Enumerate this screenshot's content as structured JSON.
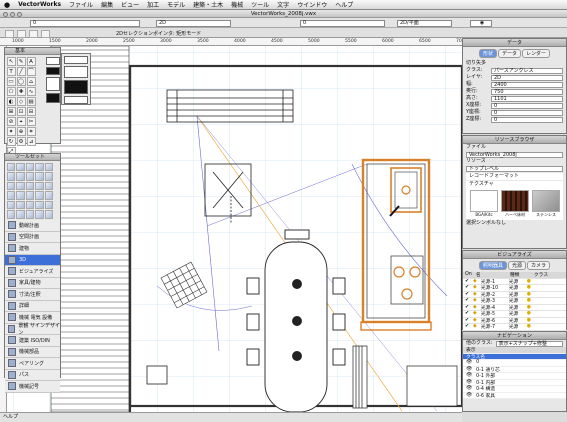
{
  "menu": {
    "app": "VectorWorks",
    "items": [
      "ファイル",
      "編集",
      "ビュー",
      "加工",
      "モデル",
      "建築・土木",
      "機械",
      "ツール",
      "文字",
      "ウインドウ",
      "ヘルプ"
    ]
  },
  "window": {
    "title": "VectorWorks_2008j.vwx"
  },
  "toolbar": {
    "class_value": "0",
    "layer_value": "2D",
    "scale_value": "0",
    "view_value": "2D/平面",
    "mode_label": "2Dセレクションポインタ: 矩形モード"
  },
  "ruler": {
    "ticks": [
      "1000",
      "1500",
      "2000",
      "2500",
      "3000",
      "3500",
      "4000",
      "4500",
      "5000",
      "5500",
      "6000",
      "6500",
      "7000"
    ]
  },
  "tools": {
    "palette_title": "基本",
    "set_title": "ツールセット",
    "sets": [
      "動線計画",
      "空間計画",
      "建物",
      "3D",
      "ビジュアライズ",
      "家具/建物",
      "寸法/注釈",
      "詳細",
      "機械 電気 設備",
      "景観 サインデザイン",
      "建築 ISO/DIN",
      "機械部品",
      "ペアリング",
      "パス",
      "機械記号"
    ],
    "selected_index": 3
  },
  "obj_info": {
    "title": "データ",
    "tabs": [
      "形状",
      "データ",
      "レンダー"
    ],
    "selected_tab": 0,
    "object_name": "切り矢多",
    "fields": [
      {
        "label": "クラス:",
        "value": "パースアンクレス"
      },
      {
        "label": "レイヤ:",
        "value": "2D"
      },
      {
        "label": "幅:",
        "value": "2400"
      },
      {
        "label": "奥行:",
        "value": "750"
      },
      {
        "label": "高さ:",
        "value": "1101"
      },
      {
        "label": "X座標:",
        "value": "0"
      },
      {
        "label": "Y座標:",
        "value": "0"
      },
      {
        "label": "Z座標:",
        "value": "0"
      }
    ]
  },
  "resource_browser": {
    "title": "リソースブラウザ",
    "file_label": "ファイル",
    "file_value": "VectorWorks_2008j",
    "resource_label": "リソース",
    "resource_value": "トップレベル",
    "folder_label": "レコードフォーマット",
    "folder2_label": "テクスチャ",
    "resources": [
      "BGA/Kitc",
      "ハーベ床材",
      "ステンレス"
    ],
    "symbol_label": "選択シンボルなし"
  },
  "visualize": {
    "title": "ビジュアライズ",
    "tabs": [
      "照明器具",
      "光源",
      "カメラ"
    ],
    "columns": [
      "On",
      "名",
      "種類",
      "クラス"
    ],
    "lights": [
      {
        "name": "光源-1",
        "type": "光源"
      },
      {
        "name": "光源-10",
        "type": "光源"
      },
      {
        "name": "光源-2",
        "type": "光源"
      },
      {
        "name": "光源-3",
        "type": "光源"
      },
      {
        "name": "光源-4",
        "type": "光源"
      },
      {
        "name": "光源-5",
        "type": "光源"
      },
      {
        "name": "光源-6",
        "type": "光源"
      },
      {
        "name": "光源-7",
        "type": "光源"
      },
      {
        "name": "光源-8",
        "type": "光源"
      }
    ]
  },
  "navigation": {
    "title": "ナビゲーション",
    "class_label": "他のクラス:",
    "class_value": "表示+スナップ+修整",
    "column_label": "表示",
    "header": "クラス名",
    "items": [
      "0",
      "0-1 通り芯",
      "0-1 外部",
      "0-1 内部",
      "0-4 構造",
      "0-6 家具"
    ],
    "selected_index": 0
  },
  "status": {
    "text": "ヘルプ"
  }
}
